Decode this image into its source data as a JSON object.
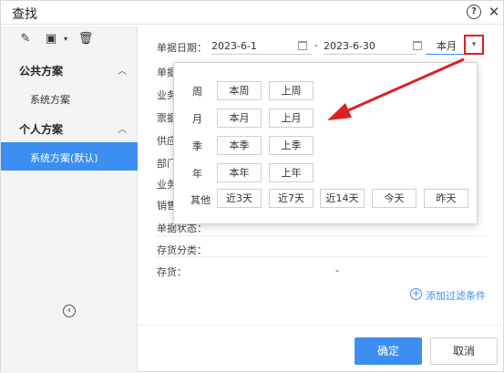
{
  "window": {
    "title": "查找"
  },
  "sidebar": {
    "groups": [
      {
        "label": "公共方案",
        "items": [
          "系统方案"
        ]
      },
      {
        "label": "个人方案",
        "items": [
          "系统方案(默认)"
        ]
      }
    ]
  },
  "form": {
    "date_label": "单据日期：",
    "date_start": "2023-6-1",
    "date_end": "2023-6-30",
    "range_dash": "-",
    "period_value": "本月",
    "rows_partial": [
      "单据",
      "业务",
      "票据",
      "供应",
      "部门",
      "业务",
      "销售"
    ],
    "status_label": "单据状态：",
    "category_label": "存货分类：",
    "inventory_label": "存货：",
    "inventory_dash": "-",
    "add_filter": "添加过滤条件"
  },
  "popup": {
    "rows": [
      {
        "label": "周",
        "options": [
          "本周",
          "上周"
        ]
      },
      {
        "label": "月",
        "options": [
          "本月",
          "上月"
        ]
      },
      {
        "label": "季",
        "options": [
          "本季",
          "上季"
        ]
      },
      {
        "label": "年",
        "options": [
          "本年",
          "上年"
        ]
      },
      {
        "label": "其他",
        "options": [
          "近3天",
          "近7天",
          "近14天",
          "今天",
          "昨天"
        ]
      }
    ]
  },
  "footer": {
    "ok_label": "确定",
    "cancel_label": "取消"
  },
  "colors": {
    "accent": "#3c8ef0",
    "highlight_arrow": "#e02020"
  }
}
